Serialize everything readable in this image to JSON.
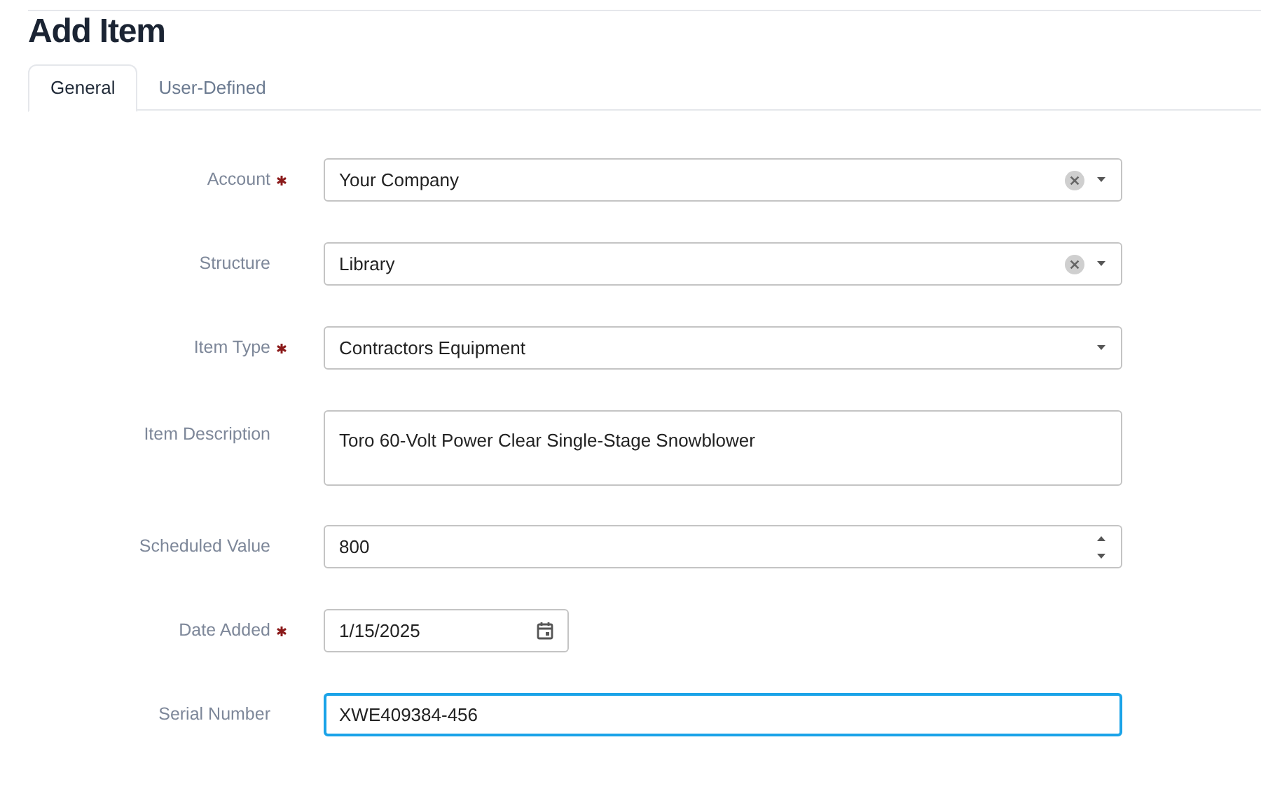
{
  "page": {
    "title": "Add Item"
  },
  "tabs": [
    {
      "label": "General",
      "selected": true
    },
    {
      "label": "User-Defined",
      "selected": false
    }
  ],
  "fields": [
    {
      "kind": "select",
      "label": "Account",
      "required": true,
      "value": "Your Company",
      "clearable": true,
      "focused": false
    },
    {
      "kind": "select",
      "label": "Structure",
      "required": false,
      "value": "Library",
      "clearable": true,
      "focused": false
    },
    {
      "kind": "select",
      "label": "Item Type",
      "required": true,
      "value": "Contractors Equipment",
      "clearable": false,
      "focused": false
    },
    {
      "kind": "textarea",
      "label": "Item Description",
      "required": false,
      "value": "Toro 60-Volt Power Clear Single-Stage Snowblower",
      "focused": false
    },
    {
      "kind": "number",
      "label": "Scheduled Value",
      "required": false,
      "value": "800",
      "focused": false
    },
    {
      "kind": "date",
      "label": "Date Added",
      "required": true,
      "value": "1/15/2025",
      "focused": false
    },
    {
      "kind": "text",
      "label": "Serial Number",
      "required": false,
      "value": "XWE409384-456",
      "focused": true
    }
  ]
}
